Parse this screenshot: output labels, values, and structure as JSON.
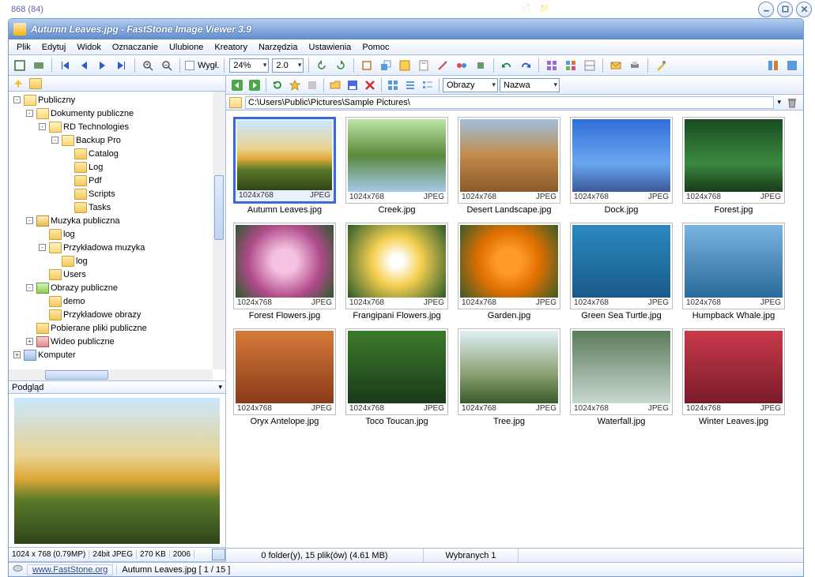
{
  "aux_coords": "868 (84)",
  "title": "Autumn Leaves.jpg  -  FastStone Image Viewer 3.9",
  "menu": [
    "Plik",
    "Edytuj",
    "Widok",
    "Oznaczanie",
    "Ulubione",
    "Kreatory",
    "Narzędzia",
    "Ustawienia",
    "Pomoc"
  ],
  "toolbar": {
    "zoom": "24%",
    "speed": "2.0",
    "view_label": "Wygł."
  },
  "rtoolbar": {
    "type_filter": "Obrazy",
    "sort": "Nazwa"
  },
  "path": "C:\\Users\\Public\\Pictures\\Sample Pictures\\",
  "tree": [
    {
      "l": 0,
      "pm": "-",
      "i": "folder-open",
      "t": "Publiczny"
    },
    {
      "l": 1,
      "pm": "-",
      "i": "folder-open",
      "t": "Dokumenty publiczne"
    },
    {
      "l": 2,
      "pm": "-",
      "i": "folder-open",
      "t": "RD Technologies"
    },
    {
      "l": 3,
      "pm": "-",
      "i": "folder-open",
      "t": "Backup Pro"
    },
    {
      "l": 4,
      "pm": "",
      "i": "folder",
      "t": "Catalog"
    },
    {
      "l": 4,
      "pm": "",
      "i": "folder",
      "t": "Log"
    },
    {
      "l": 4,
      "pm": "",
      "i": "folder",
      "t": "Pdf"
    },
    {
      "l": 4,
      "pm": "",
      "i": "folder",
      "t": "Scripts"
    },
    {
      "l": 4,
      "pm": "",
      "i": "folder",
      "t": "Tasks"
    },
    {
      "l": 1,
      "pm": "-",
      "i": "music",
      "t": "Muzyka publiczna"
    },
    {
      "l": 2,
      "pm": "",
      "i": "folder",
      "t": "log"
    },
    {
      "l": 2,
      "pm": "-",
      "i": "folder-open",
      "t": "Przykładowa muzyka"
    },
    {
      "l": 3,
      "pm": "",
      "i": "folder",
      "t": "log"
    },
    {
      "l": 2,
      "pm": "",
      "i": "folder",
      "t": "Users"
    },
    {
      "l": 1,
      "pm": "-",
      "i": "pic",
      "t": "Obrazy publiczne"
    },
    {
      "l": 2,
      "pm": "",
      "i": "folder",
      "t": "demo"
    },
    {
      "l": 2,
      "pm": "",
      "i": "folder",
      "t": "Przykładowe obrazy"
    },
    {
      "l": 1,
      "pm": "",
      "i": "folder",
      "t": "Pobierane pliki publiczne"
    },
    {
      "l": 1,
      "pm": "+",
      "i": "video",
      "t": "Wideo publiczne"
    },
    {
      "l": 0,
      "pm": "+",
      "i": "comp",
      "t": "Komputer"
    }
  ],
  "preview_label": "Podgląd",
  "info": {
    "dim": "1024 x 768 (0.79MP)",
    "depth": "24bit JPEG",
    "size": "270 KB",
    "year": "2006"
  },
  "thumbs": [
    {
      "name": "Autumn Leaves.jpg",
      "dim": "1024x768",
      "fmt": "JPEG",
      "g": "g-autumn",
      "sel": true
    },
    {
      "name": "Creek.jpg",
      "dim": "1024x768",
      "fmt": "JPEG",
      "g": "g-creek"
    },
    {
      "name": "Desert Landscape.jpg",
      "dim": "1024x768",
      "fmt": "JPEG",
      "g": "g-desert"
    },
    {
      "name": "Dock.jpg",
      "dim": "1024x768",
      "fmt": "JPEG",
      "g": "g-dock"
    },
    {
      "name": "Forest.jpg",
      "dim": "1024x768",
      "fmt": "JPEG",
      "g": "g-forest"
    },
    {
      "name": "Forest Flowers.jpg",
      "dim": "1024x768",
      "fmt": "JPEG",
      "g": "g-fflowers"
    },
    {
      "name": "Frangipani Flowers.jpg",
      "dim": "1024x768",
      "fmt": "JPEG",
      "g": "g-frangi"
    },
    {
      "name": "Garden.jpg",
      "dim": "1024x768",
      "fmt": "JPEG",
      "g": "g-garden"
    },
    {
      "name": "Green Sea Turtle.jpg",
      "dim": "1024x768",
      "fmt": "JPEG",
      "g": "g-turtle"
    },
    {
      "name": "Humpback Whale.jpg",
      "dim": "1024x768",
      "fmt": "JPEG",
      "g": "g-whale"
    },
    {
      "name": "Oryx Antelope.jpg",
      "dim": "1024x768",
      "fmt": "JPEG",
      "g": "g-oryx"
    },
    {
      "name": "Toco Toucan.jpg",
      "dim": "1024x768",
      "fmt": "JPEG",
      "g": "g-toucan"
    },
    {
      "name": "Tree.jpg",
      "dim": "1024x768",
      "fmt": "JPEG",
      "g": "g-tree"
    },
    {
      "name": "Waterfall.jpg",
      "dim": "1024x768",
      "fmt": "JPEG",
      "g": "g-waterfall"
    },
    {
      "name": "Winter Leaves.jpg",
      "dim": "1024x768",
      "fmt": "JPEG",
      "g": "g-winter"
    }
  ],
  "rstatus": {
    "summary": "0 folder(y), 15 plik(ów) (4.61 MB)",
    "selected": "Wybranych 1"
  },
  "bottom": {
    "site": "www.FastStone.org",
    "current": "Autumn Leaves.jpg [ 1 / 15 ]"
  }
}
